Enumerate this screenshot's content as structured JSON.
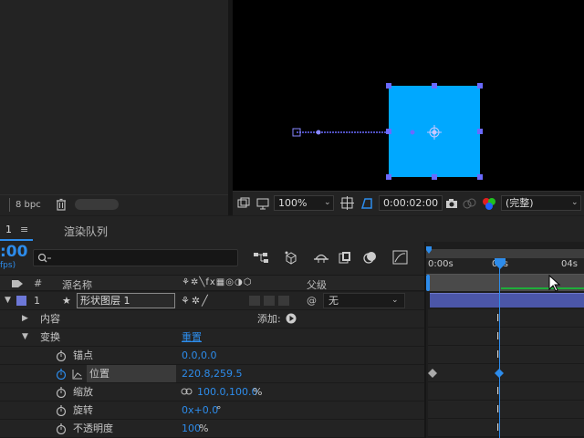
{
  "project": {
    "bpc_label": "8 bpc"
  },
  "viewer": {
    "zoom": "100%",
    "timecode": "0:00:02:00",
    "quality": "(完整)",
    "shape_color": "#00a8ff",
    "handle_color": "#6a6aff"
  },
  "timeline": {
    "tab_number": "1",
    "tab_menu": "≡",
    "render_queue_label": "渲染队列",
    "current_time": ":00",
    "fps_label": "fps)",
    "search_placeholder": "",
    "columns": {
      "hash": "#",
      "source_name": "源名称",
      "parent": "父级"
    },
    "layer": {
      "number": "1",
      "name": "形状图层 1",
      "parent_value": "无",
      "label_color": "#6d78d8"
    },
    "contents_label": "内容",
    "add_label": "添加:",
    "transform_label": "变换",
    "reset_label": "重置",
    "properties": [
      {
        "name": "锚点",
        "value": "0.0,0.0"
      },
      {
        "name": "位置",
        "value": "220.8,259.5"
      },
      {
        "name": "缩放",
        "value": "100.0,100.0",
        "unit": "%"
      },
      {
        "name": "旋转",
        "value": "0x+0.0",
        "unit": "°"
      },
      {
        "name": "不透明度",
        "value": "100",
        "unit": "%"
      }
    ],
    "ruler": {
      "label_0": "0:00s",
      "label_2": "02s",
      "label_4": "04s"
    },
    "accent_color": "#2d8ceb"
  }
}
